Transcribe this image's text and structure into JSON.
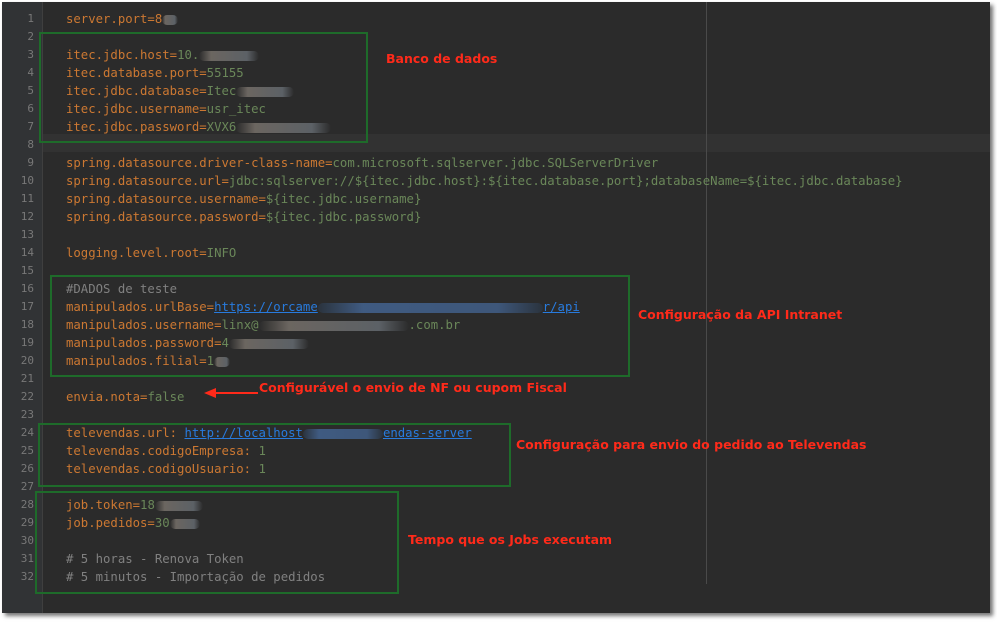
{
  "lines": [
    {
      "n": "1",
      "segs": [
        {
          "t": "server.port=8",
          "c": "k"
        },
        {
          "blur": 16
        }
      ]
    },
    {
      "n": "2",
      "segs": []
    },
    {
      "n": "3",
      "segs": [
        {
          "t": "itec.jdbc.host=",
          "c": "k"
        },
        {
          "t": "10.",
          "c": "v"
        },
        {
          "blur": 60
        }
      ]
    },
    {
      "n": "4",
      "segs": [
        {
          "t": "itec.database.port=",
          "c": "k"
        },
        {
          "t": "55155",
          "c": "v"
        }
      ]
    },
    {
      "n": "5",
      "segs": [
        {
          "t": "itec.jdbc.database=",
          "c": "k"
        },
        {
          "t": "Itec",
          "c": "v"
        },
        {
          "blur": 58
        }
      ]
    },
    {
      "n": "6",
      "segs": [
        {
          "t": "itec.jdbc.username=",
          "c": "k"
        },
        {
          "t": "usr_itec",
          "c": "v"
        }
      ]
    },
    {
      "n": "7",
      "segs": [
        {
          "t": "itec.jdbc.password=",
          "c": "k"
        },
        {
          "t": "XVX6",
          "c": "v"
        },
        {
          "blur": 95
        }
      ]
    },
    {
      "n": "8",
      "segs": []
    },
    {
      "n": "9",
      "segs": [
        {
          "t": "spring.datasource.driver-class-name=",
          "c": "k"
        },
        {
          "t": "com.microsoft.sqlserver.jdbc.SQLServerDriver",
          "c": "v"
        }
      ]
    },
    {
      "n": "10",
      "segs": [
        {
          "t": "spring.datasource.url=",
          "c": "k"
        },
        {
          "t": "jdbc:sqlserver://${itec.jdbc.host}:${itec.database.port};databaseName=${itec.jdbc.database}",
          "c": "v"
        }
      ]
    },
    {
      "n": "11",
      "segs": [
        {
          "t": "spring.datasource.username=",
          "c": "k"
        },
        {
          "t": "${itec.jdbc.username}",
          "c": "v"
        }
      ]
    },
    {
      "n": "12",
      "segs": [
        {
          "t": "spring.datasource.password=",
          "c": "k"
        },
        {
          "t": "${itec.jdbc.password}",
          "c": "v"
        }
      ]
    },
    {
      "n": "13",
      "segs": []
    },
    {
      "n": "14",
      "segs": [
        {
          "t": "logging.level.root=",
          "c": "k"
        },
        {
          "t": "INFO",
          "c": "v"
        }
      ]
    },
    {
      "n": "15",
      "segs": []
    },
    {
      "n": "16",
      "segs": [
        {
          "t": "#DADOS de teste",
          "c": "c"
        }
      ]
    },
    {
      "n": "17",
      "segs": [
        {
          "t": "manipulados.urlBase=",
          "c": "k"
        },
        {
          "t": "https://orcame",
          "c": "l"
        },
        {
          "blur": 225,
          "blue": true
        },
        {
          "t": "r/api",
          "c": "l"
        }
      ]
    },
    {
      "n": "18",
      "segs": [
        {
          "t": "manipulados.username=",
          "c": "k"
        },
        {
          "t": "linx@",
          "c": "v"
        },
        {
          "blur": 150
        },
        {
          "t": ".com.br",
          "c": "v"
        }
      ]
    },
    {
      "n": "19",
      "segs": [
        {
          "t": "manipulados.password=",
          "c": "k"
        },
        {
          "t": "4",
          "c": "v"
        },
        {
          "blur": 80
        }
      ]
    },
    {
      "n": "20",
      "segs": [
        {
          "t": "manipulados.filial=",
          "c": "k"
        },
        {
          "t": "1",
          "c": "v"
        },
        {
          "blur": 16
        }
      ]
    },
    {
      "n": "21",
      "segs": []
    },
    {
      "n": "22",
      "segs": [
        {
          "t": "envia.nota=",
          "c": "k"
        },
        {
          "t": "false",
          "c": "v"
        }
      ]
    },
    {
      "n": "23",
      "segs": []
    },
    {
      "n": "24",
      "segs": [
        {
          "t": "televendas.url: ",
          "c": "k"
        },
        {
          "t": "http://localhost",
          "c": "l"
        },
        {
          "blur": 80,
          "blue": true
        },
        {
          "t": "endas-server",
          "c": "l"
        }
      ]
    },
    {
      "n": "25",
      "segs": [
        {
          "t": "televendas.codigoEmpresa: ",
          "c": "k"
        },
        {
          "t": "1",
          "c": "v"
        }
      ]
    },
    {
      "n": "26",
      "segs": [
        {
          "t": "televendas.codigoUsuario: ",
          "c": "k"
        },
        {
          "t": "1",
          "c": "v"
        }
      ]
    },
    {
      "n": "27",
      "segs": []
    },
    {
      "n": "28",
      "segs": [
        {
          "t": "job.token=",
          "c": "k"
        },
        {
          "t": "18",
          "c": "v"
        },
        {
          "blur": 48
        }
      ]
    },
    {
      "n": "29",
      "segs": [
        {
          "t": "job.pedidos=",
          "c": "k"
        },
        {
          "t": "30",
          "c": "v"
        },
        {
          "blur": 30
        }
      ]
    },
    {
      "n": "30",
      "segs": []
    },
    {
      "n": "31",
      "segs": [
        {
          "t": "# 5 horas - Renova Token",
          "c": "c"
        }
      ]
    },
    {
      "n": "32",
      "segs": [
        {
          "t": "# 5 minutos - Importação de pedidos",
          "c": "c"
        }
      ]
    }
  ],
  "annotations": {
    "banco": "Banco de dados",
    "api": "Configuração da API Intranet",
    "nota": "Configurável o envio de NF ou cupom Fiscal",
    "televendas": "Configuração para envio do pedido ao Televendas",
    "jobs": "Tempo que os Jobs executam"
  },
  "colors": {
    "background": "#2b2b2b",
    "key": "#cc7832",
    "value": "#6a8759",
    "comment": "#808080",
    "link": "#287bde",
    "box": "#1e6b2a",
    "annotation": "#ff2a1a"
  }
}
